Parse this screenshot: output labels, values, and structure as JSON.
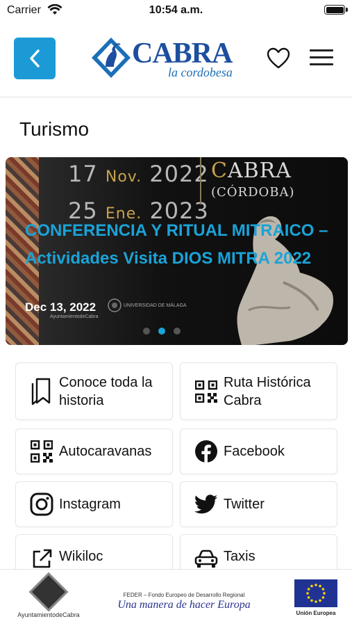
{
  "status_bar": {
    "carrier": "Carrier",
    "time": "10:54 a.m."
  },
  "header": {
    "logo_text": "CABRA",
    "logo_subtitle": "la cordobesa",
    "brand_color": "#1b9ad6"
  },
  "page": {
    "title": "Turismo"
  },
  "carousel": {
    "dates_line1": "17 Nov. 2022",
    "dates_line1_day": "17",
    "dates_line1_month": "Nov.",
    "dates_line1_year": "2022",
    "dates_line2_day": "25",
    "dates_line2_month": "Ene.",
    "dates_line2_year": "2023",
    "place_initial": "C",
    "place_rest": "ABRA",
    "place_region": "(CÓRDOBA)",
    "title": "CONFERENCIA Y RITUAL MITRAICO – Actividades Visita DIOS MITRA 2022",
    "date": "Dec 13, 2022",
    "logo_university": "UNIVERSIDAD DE MÁLAGA",
    "logo_ayto": "AyuntamientodeCabra",
    "active_slide": 2,
    "slide_count": 3
  },
  "grid": [
    {
      "label": "Conoce toda la historia",
      "icon": "bookmarks-icon"
    },
    {
      "label": "Ruta Histórica Cabra",
      "icon": "qr-code-icon"
    },
    {
      "label": "Autocaravanas",
      "icon": "qr-code-icon"
    },
    {
      "label": "Facebook",
      "icon": "facebook-icon"
    },
    {
      "label": "Instagram",
      "icon": "instagram-icon"
    },
    {
      "label": "Twitter",
      "icon": "twitter-icon"
    },
    {
      "label": "Wikiloc",
      "icon": "external-link-icon"
    },
    {
      "label": "Taxis",
      "icon": "car-icon"
    }
  ],
  "footer": {
    "ayto_label": "AyuntamientodeCabra",
    "feder_label": "FEDER – Fondo Europeo de Desarrollo Regional",
    "feder_slogan": "Una manera de hacer Europa",
    "eu_label": "Unión Europea"
  }
}
